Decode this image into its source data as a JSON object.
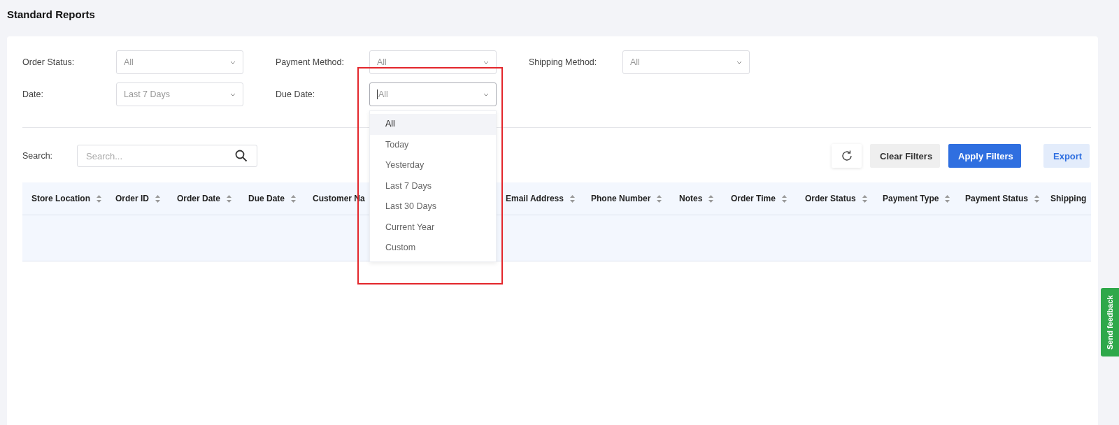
{
  "page": {
    "title": "Standard Reports"
  },
  "filters": [
    {
      "label": "Order Status:",
      "value": "All",
      "focused": false
    },
    {
      "label": "Payment Method:",
      "value": "All",
      "focused": false
    },
    {
      "label": "Shipping Method:",
      "value": "All",
      "focused": false
    },
    {
      "label": "Date:",
      "value": "Last 7 Days",
      "focused": false
    },
    {
      "label": "Due Date:",
      "value": "All",
      "focused": true,
      "expanded": true,
      "options": [
        {
          "label": "All",
          "selected": true
        },
        {
          "label": "Today",
          "selected": false
        },
        {
          "label": "Yesterday",
          "selected": false
        },
        {
          "label": "Last 7 Days",
          "selected": false
        },
        {
          "label": "Last 30 Days",
          "selected": false
        },
        {
          "label": "Current Year",
          "selected": false
        },
        {
          "label": "Custom",
          "selected": false
        }
      ]
    }
  ],
  "search": {
    "label": "Search:",
    "placeholder": "Search..."
  },
  "buttons": [
    {
      "kind": "refresh"
    },
    {
      "kind": "secondary",
      "label": "Clear Filters"
    },
    {
      "kind": "primary",
      "label": "Apply Filters"
    },
    {
      "kind": "export",
      "label": "Export"
    }
  ],
  "table": {
    "columns": [
      "Store Location",
      "Order ID",
      "Order Date",
      "Due Date",
      "Customer Na",
      "Email Address",
      "Phone Number",
      "Notes",
      "Order Time",
      "Order Status",
      "Payment Type",
      "Payment Status",
      "Shipping"
    ]
  },
  "annotations": [
    {
      "kind": "frame"
    }
  ],
  "feedback_tab": {
    "label": "Send feedback"
  }
}
